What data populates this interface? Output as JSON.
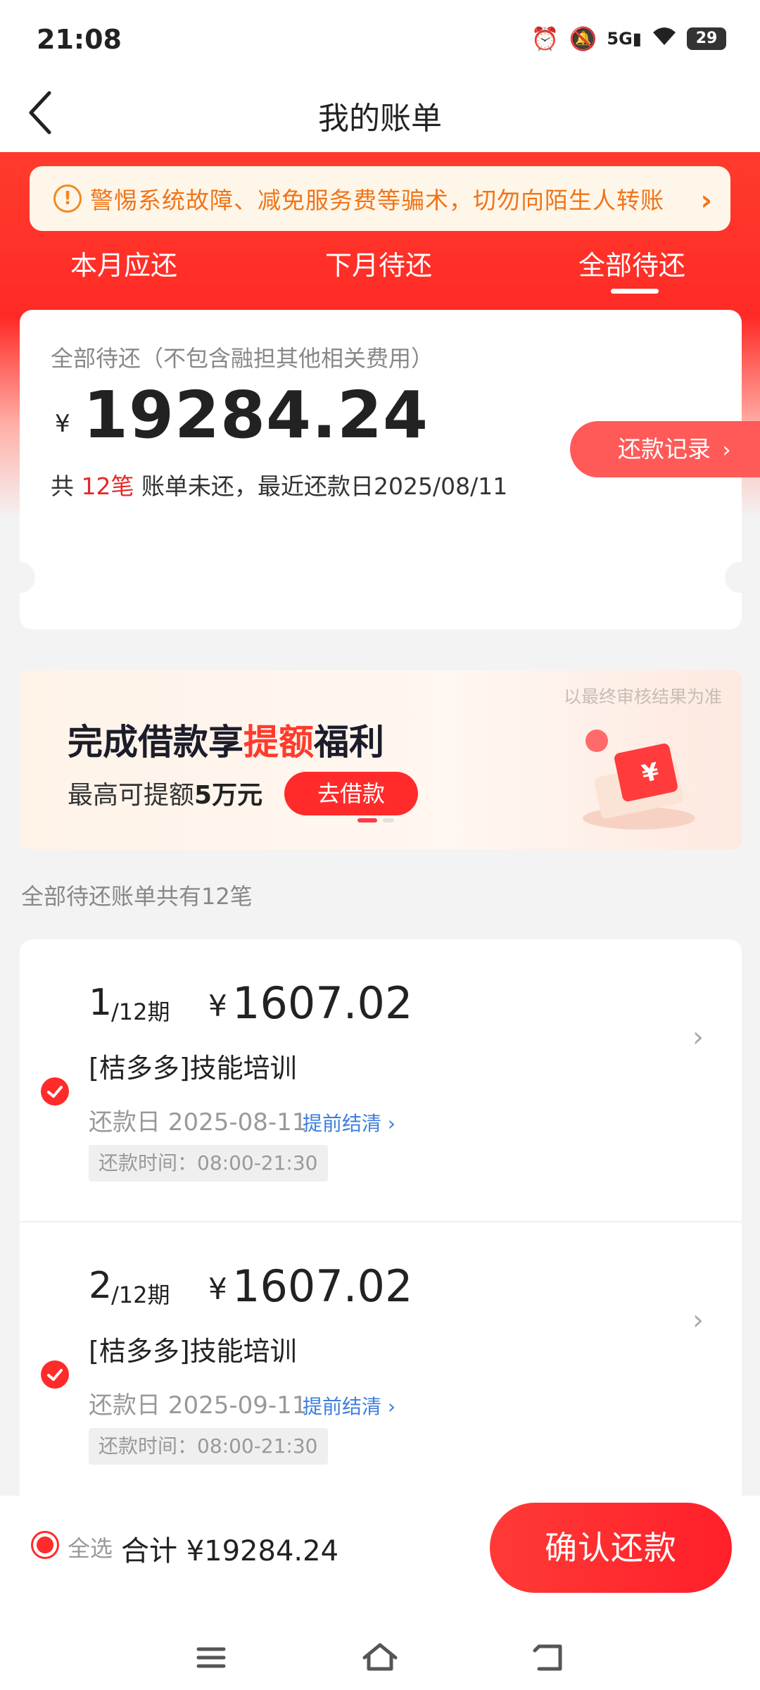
{
  "status_bar": {
    "time": "21:08",
    "battery": "29",
    "network": "5G"
  },
  "header": {
    "title": "我的账单"
  },
  "notice": {
    "text": "警惕系统故障、减免服务费等骗术，切勿向陌生人转账"
  },
  "tabs": [
    {
      "label": "本月应还",
      "active": false
    },
    {
      "label": "下月待还",
      "active": false
    },
    {
      "label": "全部待还",
      "active": true
    }
  ],
  "summary": {
    "subtitle": "全部待还（不包含融担其他相关费用）",
    "currency": "¥",
    "amount": "19284.24",
    "line_prefix": "共",
    "count_text": "12笔",
    "line_suffix": "账单未还，最近还款日2025/08/11",
    "record_button": "还款记录"
  },
  "banner": {
    "note": "以最终审核结果为准",
    "title_part1": "完成借款享",
    "title_highlight": "提额",
    "title_part2": "福利",
    "subtitle_part1": "最高可提额",
    "subtitle_bold": "5万元",
    "button": "去借款"
  },
  "list_caption": "全部待还账单共有12笔",
  "bills": [
    {
      "period": "1",
      "total_periods": "/12期",
      "currency": "¥",
      "amount": "1607.02",
      "name": "[桔多多]技能培训",
      "due_date": "还款日 2025-08-11",
      "early_label": "提前结清",
      "hours": "还款时间：08:00-21:30",
      "checked": true
    },
    {
      "period": "2",
      "total_periods": "/12期",
      "currency": "¥",
      "amount": "1607.02",
      "name": "[桔多多]技能培训",
      "due_date": "还款日 2025-09-11",
      "early_label": "提前结清",
      "hours": "还款时间：08:00-21:30",
      "checked": true
    }
  ],
  "bottom": {
    "select_all": "全选",
    "total": "合计 ¥19284.24",
    "confirm": "确认还款"
  },
  "colors": {
    "brand_red": "#ff2b2a",
    "notice_orange": "#f07518",
    "link_blue": "#3c7ee0"
  },
  "icons": [
    "back-icon",
    "alarm-icon",
    "mute-icon",
    "signal-icon",
    "wifi-icon",
    "battery-icon",
    "warning-icon",
    "chevron-right-icon",
    "check-icon",
    "menu-icon",
    "home-icon",
    "back-nav-icon"
  ]
}
